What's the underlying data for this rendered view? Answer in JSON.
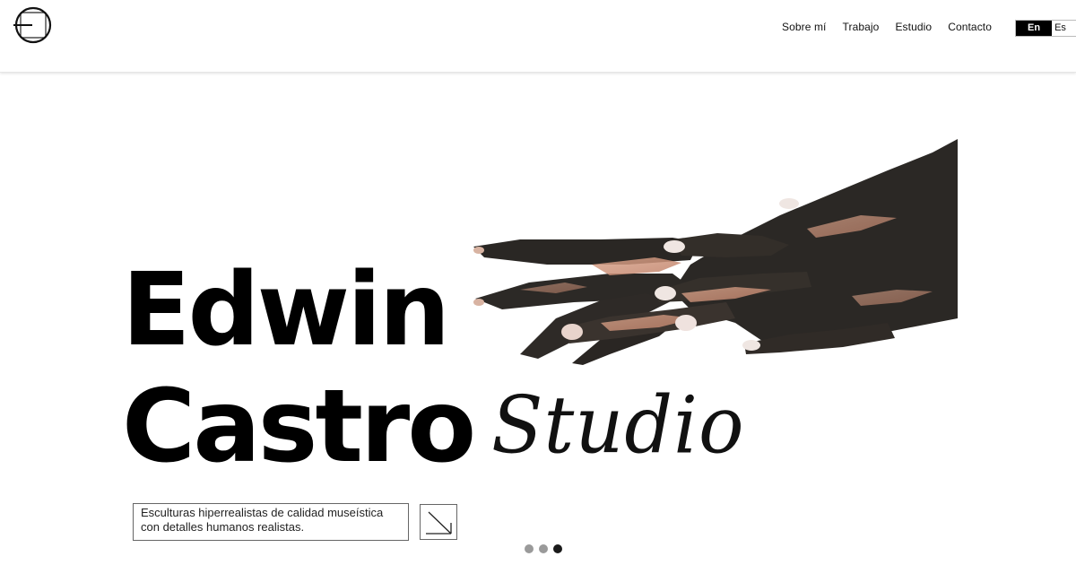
{
  "header": {
    "logo_icon": "circle-frame-logo-icon",
    "nav": [
      {
        "label": "Sobre mí"
      },
      {
        "label": "Trabajo"
      },
      {
        "label": "Estudio"
      },
      {
        "label": "Contacto"
      }
    ],
    "languages": {
      "active": "En",
      "inactive": "Es"
    }
  },
  "hero": {
    "line1": "Edwin",
    "line2": "Castro",
    "script_word": "Studio",
    "image_subject": "sculpted-hands-image",
    "tagline": {
      "line1": "Esculturas hiperrealistas de calidad museística",
      "line2": "con detalles humanos realistas."
    },
    "arrow_icon": "arrow-down-right-icon"
  },
  "carousel": {
    "dots_count": 3,
    "active_index": 2
  },
  "colors": {
    "text": "#111111",
    "accent": "#000000",
    "dot_inactive": "#9a9a9a",
    "dot_active": "#1a1a1a"
  }
}
